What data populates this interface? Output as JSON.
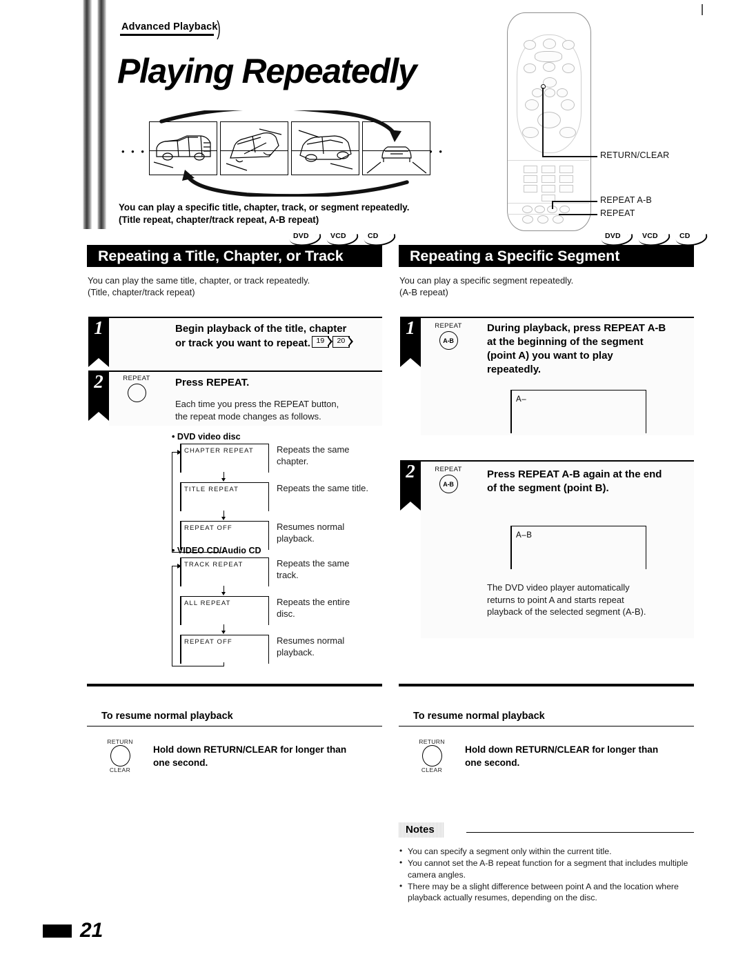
{
  "document": {
    "chapter_tag": "Advanced Playback",
    "title": "Playing Repeatedly",
    "page_number": "21",
    "intro_line1": "You can play a specific title, chapter, track, or segment repeatedly.",
    "intro_line2": "(Title repeat, chapter/track repeat, A-B repeat)",
    "illustration_dots_left": "• • •",
    "illustration_dots_right": "• • •"
  },
  "disc_badges": [
    "DVD",
    "VCD",
    "CD"
  ],
  "remote": {
    "callouts": [
      {
        "label": "RETURN/CLEAR"
      },
      {
        "label": "REPEAT A-B"
      },
      {
        "label": "REPEAT"
      }
    ]
  },
  "left_section": {
    "header": "Repeating a Title, Chapter, or Track",
    "desc_line1": "You can play the same title, chapter, or track repeatedly.",
    "desc_line2": "(Title, chapter/track repeat)",
    "step1": {
      "number": "1",
      "title_line1": "Begin playback of the title, chapter",
      "title_line2": "or track you want to repeat.",
      "pagerefs": [
        "19",
        "20"
      ]
    },
    "step2": {
      "number": "2",
      "button_caption": "REPEAT",
      "title": "Press REPEAT.",
      "body_line1": "Each time you press the REPEAT button,",
      "body_line2": "the repeat mode changes as follows."
    },
    "flows": [
      {
        "heading": "• DVD video disc",
        "items": [
          {
            "osd": "CHAPTER REPEAT",
            "desc_line1": "Repeats the same",
            "desc_line2": "chapter."
          },
          {
            "osd": "TITLE REPEAT",
            "desc_line1": "Repeats the same title.",
            "desc_line2": ""
          },
          {
            "osd": "REPEAT OFF",
            "desc_line1": "Resumes normal",
            "desc_line2": "playback."
          }
        ]
      },
      {
        "heading": "• VIDEO CD/Audio CD",
        "items": [
          {
            "osd": "TRACK REPEAT",
            "desc_line1": "Repeats the same",
            "desc_line2": "track."
          },
          {
            "osd": "ALL REPEAT",
            "desc_line1": "Repeats the entire",
            "desc_line2": "disc."
          },
          {
            "osd": "REPEAT OFF",
            "desc_line1": "Resumes normal",
            "desc_line2": "playback."
          }
        ]
      }
    ],
    "resume": {
      "heading": "To resume normal playback",
      "button_top": "RETURN",
      "button_bottom": "CLEAR",
      "text_line1": "Hold down RETURN/CLEAR for longer than",
      "text_line2": "one second."
    }
  },
  "right_section": {
    "header": "Repeating a Specific Segment",
    "desc_line1": "You can play a specific segment repeatedly.",
    "desc_line2": "(A-B repeat)",
    "step1": {
      "number": "1",
      "button_caption": "REPEAT",
      "button_label": "A-B",
      "title_line1": "During playback, press REPEAT A-B",
      "title_line2": "at the beginning of the segment",
      "title_line3": "(point A) you want to play",
      "title_line4": "repeatedly.",
      "display": "A–"
    },
    "step2": {
      "number": "2",
      "button_caption": "REPEAT",
      "button_label": "A-B",
      "title_line1": "Press REPEAT A-B again at the end",
      "title_line2": "of the segment (point B).",
      "display": "A–B",
      "body_line1": "The DVD video player automatically",
      "body_line2": "returns to point A and starts repeat",
      "body_line3": "playback of the selected segment (A-B)."
    },
    "resume": {
      "heading": "To resume normal playback",
      "button_top": "RETURN",
      "button_bottom": "CLEAR",
      "text_line1": "Hold down RETURN/CLEAR for longer than",
      "text_line2": "one second."
    },
    "notes": {
      "heading": "Notes",
      "items": [
        "You can specify a segment only within the current title.",
        "You cannot set the A-B repeat function for a segment that includes multiple camera angles.",
        "There may be a slight difference between point A and the location where playback actually resumes, depending on the disc."
      ]
    }
  }
}
